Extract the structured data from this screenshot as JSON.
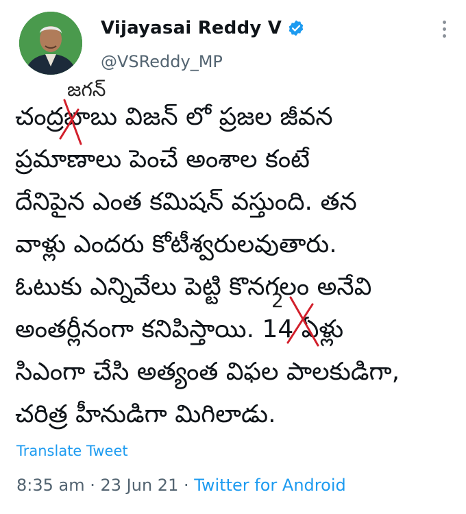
{
  "author": {
    "display_name": "Vijayasai Reddy V",
    "handle": "@VSReddy_MP",
    "verified": true,
    "avatar_icon": "profile-photo"
  },
  "tweet": {
    "lines": [
      "చంద్రబాబు విజన్ లో ప్రజల జీవన",
      "ప్రమాణాలు పెంచే అంశాల కంటే",
      "దేనిపైన ఎంత కమిషన్ వస్తుంది. తన",
      "వాళ్లు ఎందరు కోటీశ్వరులవుతారు.",
      "ఓటుకు ఎన్నివేలు పెట్టి కొనగలం అనేవి",
      "అంతర్లీనంగా కనిపిస్తాయి. 14 ఏళ్లు",
      "సిఎంగా చేసి అత్యంత విఫల పాలకుడిగా,",
      "చరిత్ర హీనుడిగా మిగిలాడు."
    ],
    "handwritten_annotations": {
      "above_name": "జగన్",
      "above_number": "2"
    }
  },
  "actions": {
    "translate_label": "Translate Tweet"
  },
  "meta": {
    "time": "8:35 am",
    "separator": " · ",
    "date": "23 Jun 21",
    "source": "Twitter for Android"
  },
  "colors": {
    "link": "#1d9bf0",
    "secondary_text": "#536471",
    "annotation_red": "#d21f2b"
  }
}
